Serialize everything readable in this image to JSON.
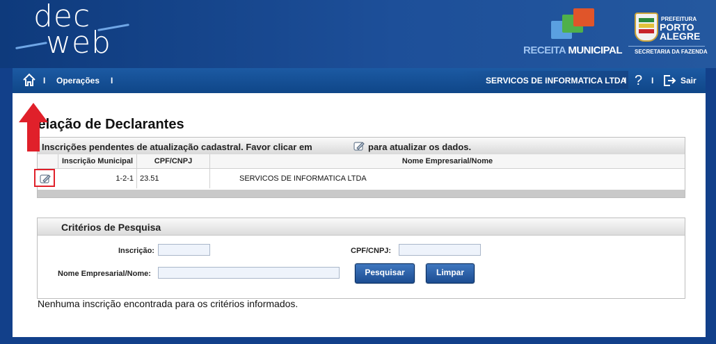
{
  "header": {
    "logo_line1": "dec",
    "logo_line2": "web",
    "receita_light": "RECEITA",
    "receita_bold": " MUNICIPAL",
    "prefeitura_small": "PREFEITURA",
    "prefeitura_big1": "PORTO",
    "prefeitura_big2": "ALEGRE",
    "secretaria": "SECRETARIA DA FAZENDA"
  },
  "nav": {
    "sep": "I",
    "operacoes": "Operações",
    "company": "SERVICOS DE INFORMATICA LTDA",
    "help": "?",
    "sair": "Sair"
  },
  "page": {
    "title": "Relação de Declarantes"
  },
  "pending": {
    "heading_before": "Inscrições pendentes de atualização cadastral. Favor clicar em",
    "heading_after": "para atualizar os dados.",
    "columns": [
      "Inscrição Municipal",
      "CPF/CNPJ",
      "Nome Empresarial/Nome"
    ],
    "rows": [
      {
        "inscricao": "1-2-1",
        "cpf_cnpj": "23.51",
        "nome": "SERVICOS DE INFORMATICA LTDA"
      }
    ]
  },
  "search": {
    "heading": "Critérios de Pesquisa",
    "inscricao_label": "Inscrição:",
    "inscricao_value": "",
    "cpf_label": "CPF/CNPJ:",
    "cpf_value": "",
    "nome_label": "Nome Empresarial/Nome:",
    "nome_value": "",
    "pesquisar": "Pesquisar",
    "limpar": "Limpar"
  },
  "message": "Nenhuma inscrição encontrada para os critérios informados.",
  "colors": {
    "brand_blue": "#12408a",
    "nav_blue": "#1c5aa3",
    "highlight_red": "#e0202a"
  },
  "icons": {
    "home": "home-icon",
    "edit": "edit-icon",
    "help": "help-icon",
    "logout": "logout-icon",
    "arrow": "red-arrow-up-icon"
  }
}
